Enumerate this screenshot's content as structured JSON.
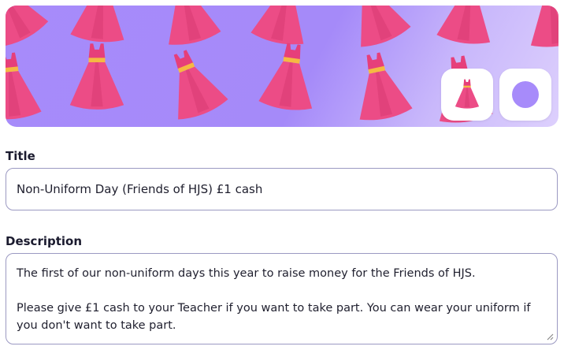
{
  "banner": {
    "background_colors": [
      "#a78bfa",
      "#ddd0fd"
    ],
    "pattern_icon": "dress-icon",
    "emoji_button_icon": "dress-icon",
    "color_button_swatch": "#a78bfa"
  },
  "form": {
    "title_label": "Title",
    "title_value": "Non-Uniform Day (Friends of HJS) £1 cash",
    "description_label": "Description",
    "description_paragraphs": [
      "The first of our non-uniform days this year to raise money for the Friends of HJS.",
      "Please give £1 cash to your Teacher if you want to take part.  You can wear your uniform if you don't want to take part."
    ]
  }
}
